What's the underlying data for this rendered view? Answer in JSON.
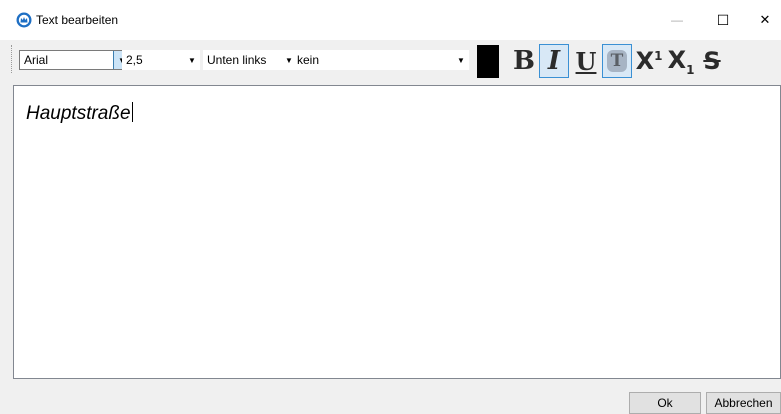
{
  "window": {
    "title": "Text bearbeiten",
    "controls": {
      "minimize": "—",
      "maximize": "☐",
      "close": "✕"
    },
    "app_icon": "app-logo-icon"
  },
  "toolbar": {
    "font": {
      "value": "Arial"
    },
    "size": {
      "value": "2,5"
    },
    "position": {
      "value": "Unten links"
    },
    "frame": {
      "value": "kein"
    },
    "color": {
      "value": "#000000"
    },
    "buttons": {
      "bold": "B",
      "italic": "I",
      "underline": "U",
      "textbox": "T",
      "superscript": {
        "base": "X",
        "script": "1"
      },
      "subscript": {
        "base": "X",
        "script": "1"
      },
      "strikethrough": "S"
    },
    "active": [
      "italic",
      "textbox"
    ]
  },
  "editor": {
    "text": "Hauptstraße"
  },
  "dialog_buttons": {
    "ok": "Ok",
    "cancel": "Abbrechen"
  }
}
